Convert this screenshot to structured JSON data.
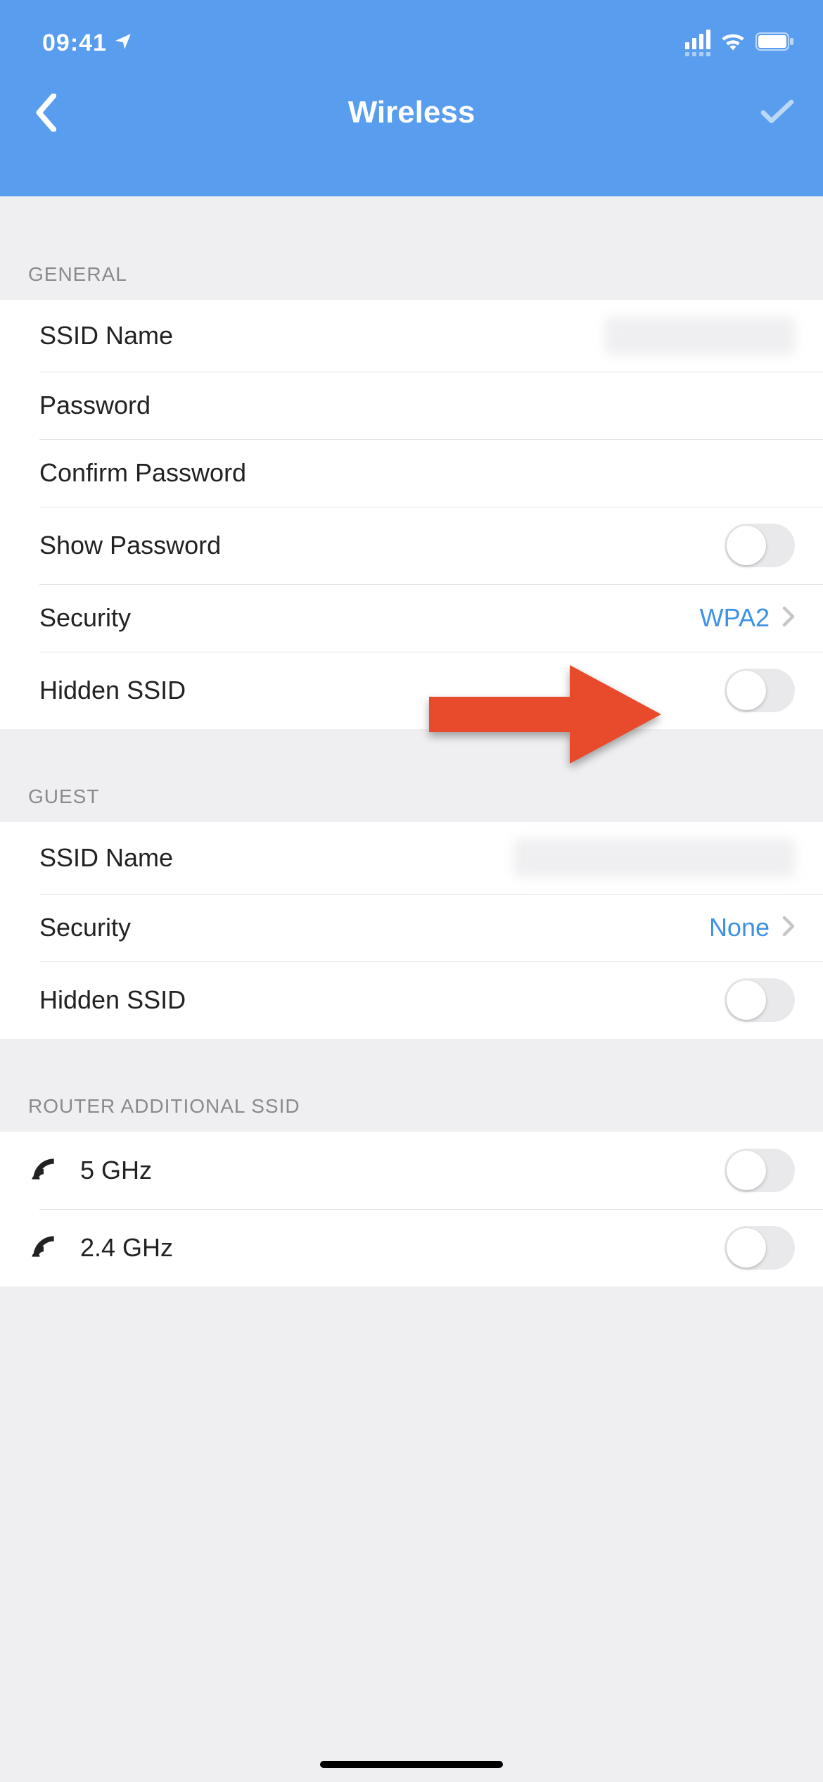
{
  "status": {
    "time": "09:41"
  },
  "nav": {
    "title": "Wireless"
  },
  "sections": {
    "general": {
      "header": "GENERAL",
      "ssid_label": "SSID Name",
      "password_label": "Password",
      "confirm_password_label": "Confirm Password",
      "show_password_label": "Show Password",
      "show_password_on": false,
      "security_label": "Security",
      "security_value": "WPA2",
      "hidden_ssid_label": "Hidden SSID",
      "hidden_ssid_on": false
    },
    "guest": {
      "header": "GUEST",
      "ssid_label": "SSID Name",
      "security_label": "Security",
      "security_value": "None",
      "hidden_ssid_label": "Hidden SSID",
      "hidden_ssid_on": false
    },
    "router_additional": {
      "header": "ROUTER ADDITIONAL SSID",
      "band5_label": "5 GHz",
      "band5_on": false,
      "band24_label": "2.4 GHz",
      "band24_on": false
    }
  },
  "colors": {
    "header_bg": "#599DEE",
    "accent": "#3E92E6",
    "annotation": "#E84B2C"
  }
}
